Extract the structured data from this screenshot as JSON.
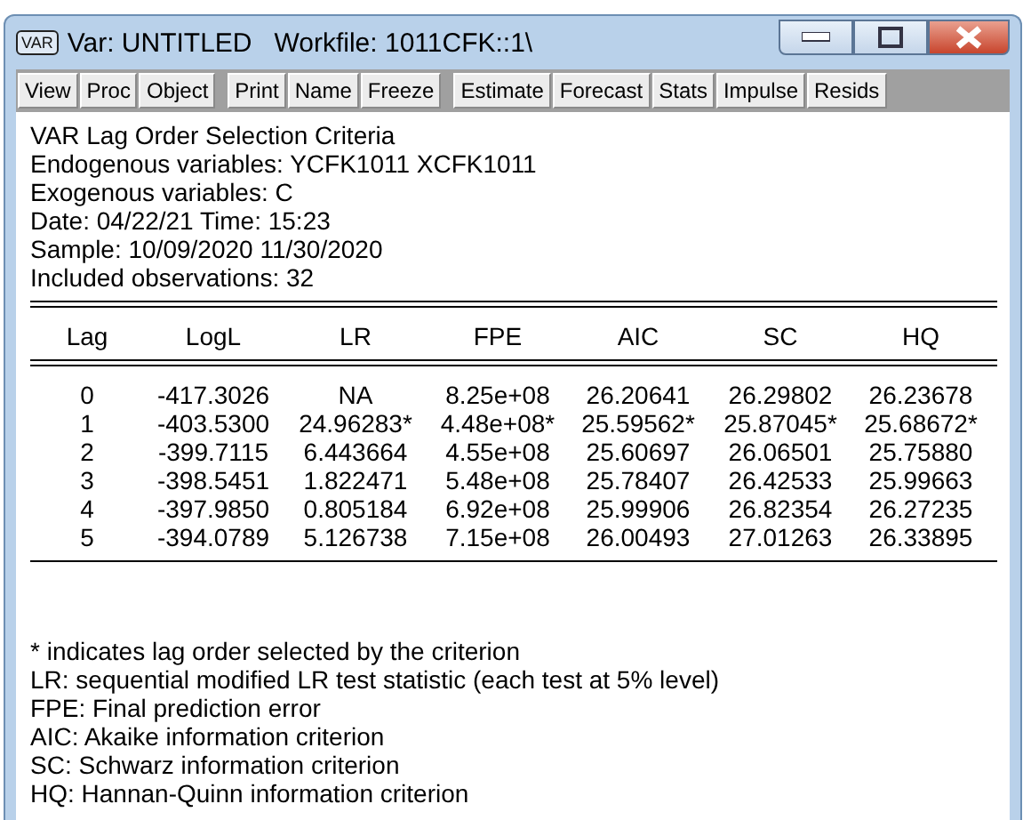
{
  "window": {
    "title": "Var: UNTITLED   Workfile: 1011CFK::1\\",
    "icon_text": "VAR"
  },
  "toolbar": [
    [
      "View",
      "Proc",
      "Object"
    ],
    [
      "Print",
      "Name",
      "Freeze"
    ],
    [
      "Estimate",
      "Forecast",
      "Stats",
      "Impulse",
      "Resids"
    ]
  ],
  "header_lines": [
    "VAR Lag Order Selection Criteria",
    "Endogenous variables: YCFK1011 XCFK1011",
    "Exogenous variables: C",
    "Date: 04/22/21   Time: 15:23",
    "Sample: 10/09/2020 11/30/2020",
    "Included observations: 32"
  ],
  "table": {
    "columns": [
      "Lag",
      "LogL",
      "LR",
      "FPE",
      "AIC",
      "SC",
      "HQ"
    ],
    "rows": [
      [
        "0",
        "-417.3026",
        "NA",
        "8.25e+08",
        "26.20641",
        "26.29802",
        "26.23678"
      ],
      [
        "1",
        "-403.5300",
        "24.96283*",
        "4.48e+08*",
        "25.59562*",
        "25.87045*",
        "25.68672*"
      ],
      [
        "2",
        "-399.7115",
        "6.443664",
        "4.55e+08",
        "25.60697",
        "26.06501",
        "25.75880"
      ],
      [
        "3",
        "-398.5451",
        "1.822471",
        "5.48e+08",
        "25.78407",
        "26.42533",
        "25.99663"
      ],
      [
        "4",
        "-397.9850",
        "0.805184",
        "6.92e+08",
        "25.99906",
        "26.82354",
        "26.27235"
      ],
      [
        "5",
        "-394.0789",
        "5.126738",
        "7.15e+08",
        "26.00493",
        "27.01263",
        "26.33895"
      ]
    ]
  },
  "footnotes": [
    "* indicates lag order selected by the criterion",
    "LR: sequential modified LR test statistic (each test at 5% level)",
    "FPE: Final prediction error",
    "AIC: Akaike information criterion",
    "SC: Schwarz information criterion",
    "HQ: Hannan-Quinn information criterion"
  ]
}
